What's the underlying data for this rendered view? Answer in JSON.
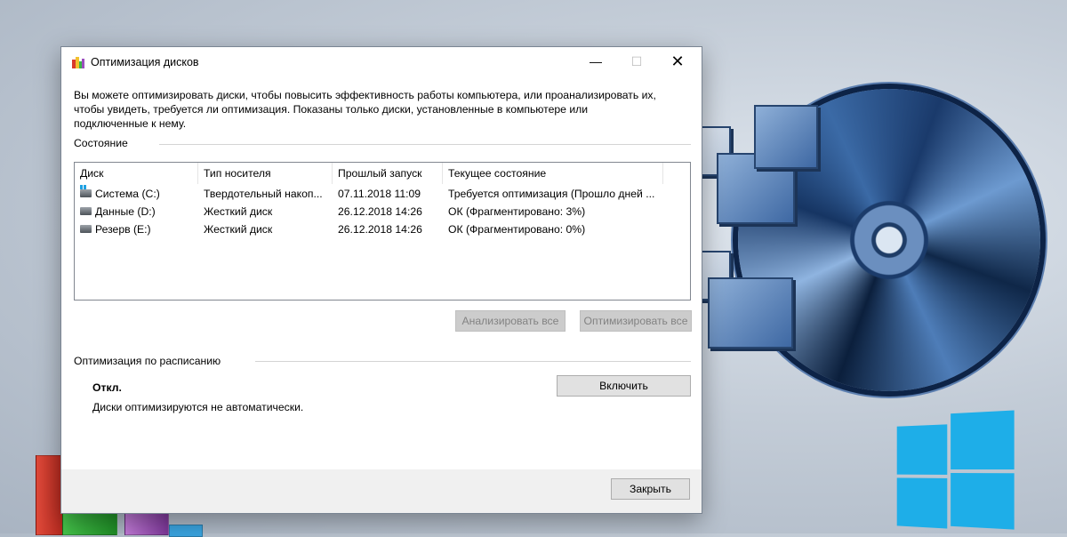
{
  "window": {
    "title": "Оптимизация дисков",
    "description": "Вы можете оптимизировать диски, чтобы повысить эффективность работы  компьютера, или проанализировать их, чтобы увидеть, требуется ли оптимизация. Показаны только диски, установленные в компьютере или подключенные к нему.",
    "controls": {
      "minimize": "—",
      "maximize": "☐",
      "close": "✕"
    }
  },
  "status_section": {
    "label": "Состояние",
    "columns": [
      "Диск",
      "Тип носителя",
      "Прошлый запуск",
      "Текущее состояние"
    ],
    "rows": [
      {
        "icon": "system-drive-icon",
        "disk": "Система (C:)",
        "media": "Твердотельный накоп...",
        "last_run": "07.11.2018 11:09",
        "status": "Требуется оптимизация (Прошло дней ..."
      },
      {
        "icon": "hard-drive-icon",
        "disk": "Данные (D:)",
        "media": "Жесткий диск",
        "last_run": "26.12.2018 14:26",
        "status": "ОК (Фрагментировано: 3%)"
      },
      {
        "icon": "hard-drive-icon",
        "disk": "Резерв (E:)",
        "media": "Жесткий диск",
        "last_run": "26.12.2018 14:26",
        "status": "ОК (Фрагментировано: 0%)"
      }
    ],
    "analyze_all": "Анализировать все",
    "optimize_all": "Оптимизировать все"
  },
  "schedule_section": {
    "label": "Оптимизация по расписанию",
    "state": "Откл.",
    "description": "Диски оптимизируются не автоматически.",
    "enable_button": "Включить"
  },
  "footer": {
    "close_button": "Закрыть"
  },
  "colors": {
    "windows_logo": "#1eaee8",
    "disc": "#1a3a6b"
  }
}
